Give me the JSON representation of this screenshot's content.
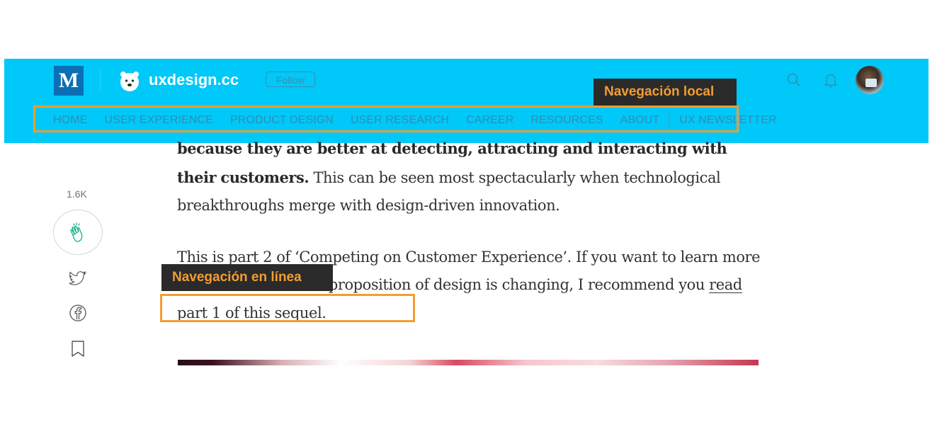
{
  "header": {
    "medium_logo": "M",
    "publication": "uxdesign.cc",
    "follow_label": "Follow",
    "icons": [
      "medium-logo",
      "polar-bear-logo",
      "search-icon",
      "bell-icon",
      "avatar"
    ]
  },
  "nav": {
    "items": [
      "HOME",
      "USER EXPERIENCE",
      "PRODUCT DESIGN",
      "USER RESEARCH",
      "CAREER",
      "RESOURCES",
      "ABOUT"
    ],
    "newsletter": "UX NEWSLETTER"
  },
  "annotations": {
    "local_nav": "Navegación local",
    "inline_nav": "Navegación en línea"
  },
  "sidebar": {
    "clap_count": "1.6K",
    "icons": [
      "clap-icon",
      "twitter-icon",
      "facebook-icon",
      "bookmark-icon"
    ]
  },
  "article": {
    "p1_bold_a": "because they are better at detecting, attracting and interacting with their",
    "p1_bold_b": "customers.",
    "p1_rest": " This can be seen most spectacularly when technological breakthroughs merge with design-driven innovation.",
    "p2_a": "This is part 2 of ‘Competing on Customer Experience’. If you want to learn more about how the value proposition of design is changing, I recommend you ",
    "p2_link": "read part 1 of this sequel",
    "p2_end": "."
  },
  "colors": {
    "header_bg": "#00c8f8",
    "annotation_border": "#f39c32",
    "annotation_label_bg": "#2a2a2a"
  }
}
